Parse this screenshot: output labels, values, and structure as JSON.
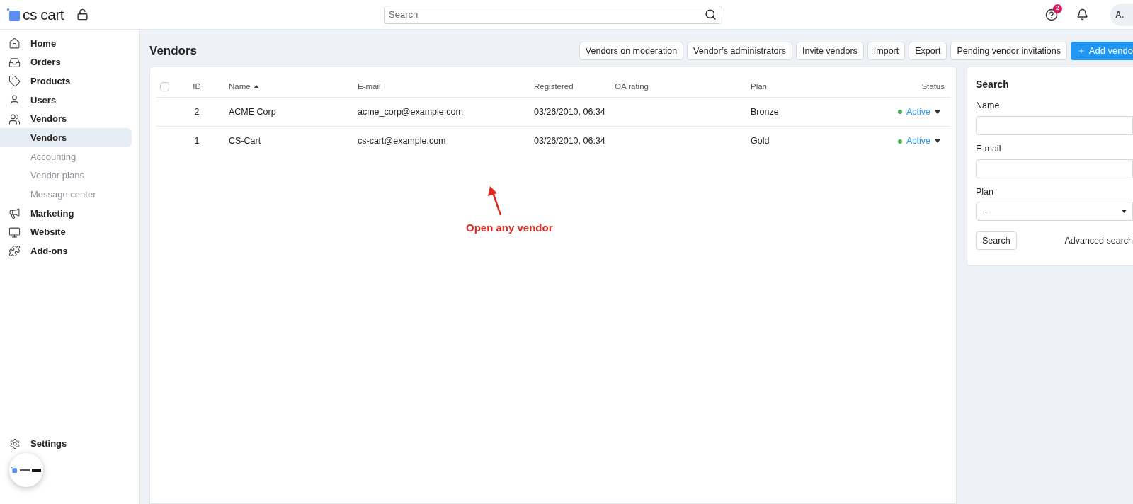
{
  "header": {
    "logo": "cs cart",
    "search": {
      "placeholder": "Search"
    },
    "help_badge": "2",
    "avatar": "A."
  },
  "sidebar": {
    "items": [
      {
        "label": "Home",
        "selected": false
      },
      {
        "label": "Orders",
        "selected": false
      },
      {
        "label": "Products",
        "selected": false
      },
      {
        "label": "Users",
        "selected": false
      },
      {
        "label": "Vendors",
        "selected": false,
        "children": [
          {
            "label": "Vendors",
            "selected": true
          },
          {
            "label": "Accounting",
            "selected": false
          },
          {
            "label": "Vendor plans",
            "selected": false
          },
          {
            "label": "Message center",
            "selected": false
          }
        ]
      },
      {
        "label": "Marketing",
        "selected": false
      },
      {
        "label": "Website",
        "selected": false
      },
      {
        "label": "Add-ons",
        "selected": false
      }
    ],
    "settings": "Settings"
  },
  "page": {
    "title": "Vendors",
    "actions": [
      {
        "label": "Vendors on moderation",
        "kind": "plain"
      },
      {
        "label": "Vendor’s administrators",
        "kind": "plain"
      },
      {
        "label": "Invite vendors",
        "kind": "plain"
      },
      {
        "label": "Import",
        "kind": "plain"
      },
      {
        "label": "Export",
        "kind": "plain"
      },
      {
        "label": "Pending vendor invitations",
        "kind": "plain"
      },
      {
        "label": "Add vendo",
        "kind": "primary"
      }
    ]
  },
  "table": {
    "select_all": {
      "checked": false
    },
    "columns": [
      {
        "label": "ID",
        "sorted": false
      },
      {
        "label": "Name",
        "sorted": true
      },
      {
        "label": "E-mail",
        "sorted": false
      },
      {
        "label": "Registered",
        "sorted": false
      },
      {
        "label": "OA rating",
        "sorted": false
      },
      {
        "label": "Plan",
        "sorted": false
      },
      {
        "label": "Status",
        "sorted": false
      }
    ],
    "rows": [
      {
        "id": "2",
        "name": "ACME Corp",
        "email": "acme_corp@example.com",
        "registered": "03/26/2010, 06:34",
        "plan": "Bronze",
        "status": "Active",
        "color": "#4caf50"
      },
      {
        "id": "1",
        "name": "CS-Cart",
        "email": "cs-cart@example.com",
        "registered": "03/26/2010, 06:34",
        "plan": "Gold",
        "status": "Active",
        "color": "#4caf50"
      }
    ]
  },
  "annotation": "Open any vendor",
  "search_panel": {
    "title": "Search",
    "fields": [
      {
        "label": "Name",
        "kind": "text"
      },
      {
        "label": "E-mail",
        "kind": "text"
      },
      {
        "label": "Plan",
        "kind": "select",
        "value": "--"
      }
    ],
    "button": "Search",
    "link": "Advanced search"
  }
}
